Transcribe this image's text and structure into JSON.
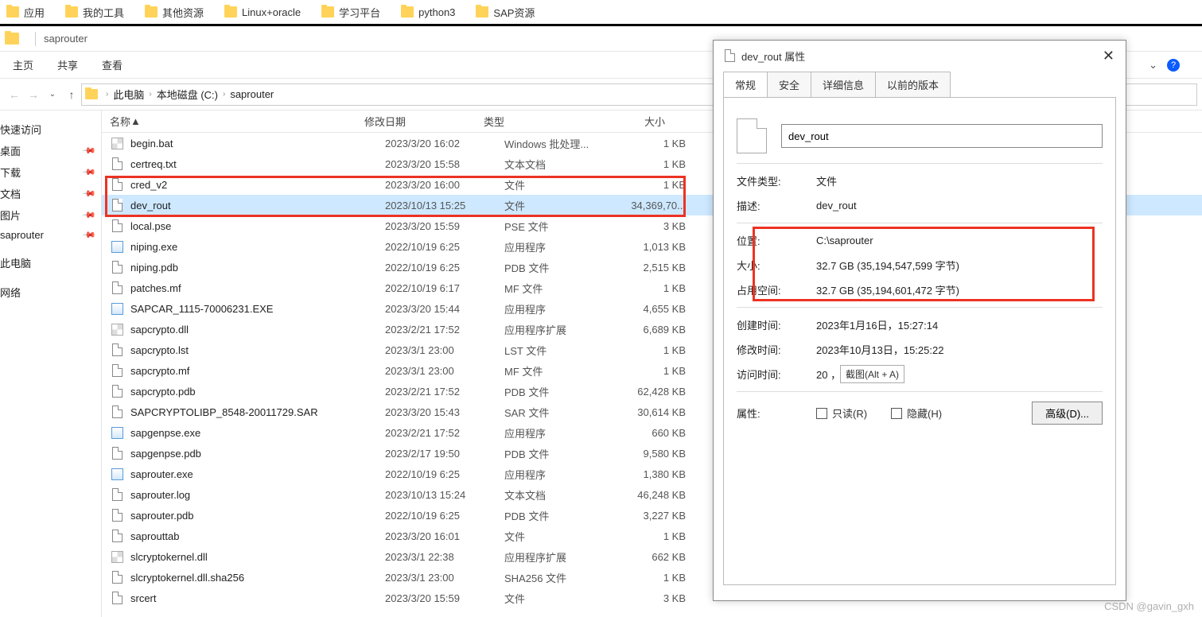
{
  "bookmarks": [
    "应用",
    "我的工具",
    "其他资源",
    "Linux+oracle",
    "学习平台",
    "python3",
    "SAP资源"
  ],
  "window_title": "saprouter",
  "ribbon": {
    "home": "主页",
    "share": "共享",
    "view": "查看"
  },
  "breadcrumb": {
    "pc": "此电脑",
    "drive": "本地磁盘 (C:)",
    "folder": "saprouter"
  },
  "columns": {
    "name": "名称",
    "date": "修改日期",
    "type": "类型",
    "size": "大小"
  },
  "sidebar": {
    "quick": "快速访问",
    "items": [
      "桌面",
      "下载",
      "文档",
      "图片",
      "saprouter"
    ],
    "pc": "此电脑",
    "net": "网络"
  },
  "files": [
    {
      "n": "begin.bat",
      "d": "2023/3/20 16:02",
      "t": "Windows 批处理...",
      "s": "1 KB",
      "ic": "sys"
    },
    {
      "n": "certreq.txt",
      "d": "2023/3/20 15:58",
      "t": "文本文档",
      "s": "1 KB",
      "ic": "file"
    },
    {
      "n": "cred_v2",
      "d": "2023/3/20 16:00",
      "t": "文件",
      "s": "1 KB",
      "ic": "file"
    },
    {
      "n": "dev_rout",
      "d": "2023/10/13 15:25",
      "t": "文件",
      "s": "34,369,70...",
      "ic": "file",
      "sel": true
    },
    {
      "n": "local.pse",
      "d": "2023/3/20 15:59",
      "t": "PSE 文件",
      "s": "3 KB",
      "ic": "file"
    },
    {
      "n": "niping.exe",
      "d": "2022/10/19 6:25",
      "t": "应用程序",
      "s": "1,013 KB",
      "ic": "exe"
    },
    {
      "n": "niping.pdb",
      "d": "2022/10/19 6:25",
      "t": "PDB 文件",
      "s": "2,515 KB",
      "ic": "file"
    },
    {
      "n": "patches.mf",
      "d": "2022/10/19 6:17",
      "t": "MF 文件",
      "s": "1 KB",
      "ic": "file"
    },
    {
      "n": "SAPCAR_1115-70006231.EXE",
      "d": "2023/3/20 15:44",
      "t": "应用程序",
      "s": "4,655 KB",
      "ic": "exe"
    },
    {
      "n": "sapcrypto.dll",
      "d": "2023/2/21 17:52",
      "t": "应用程序扩展",
      "s": "6,689 KB",
      "ic": "sys"
    },
    {
      "n": "sapcrypto.lst",
      "d": "2023/3/1 23:00",
      "t": "LST 文件",
      "s": "1 KB",
      "ic": "file"
    },
    {
      "n": "sapcrypto.mf",
      "d": "2023/3/1 23:00",
      "t": "MF 文件",
      "s": "1 KB",
      "ic": "file"
    },
    {
      "n": "sapcrypto.pdb",
      "d": "2023/2/21 17:52",
      "t": "PDB 文件",
      "s": "62,428 KB",
      "ic": "file"
    },
    {
      "n": "SAPCRYPTOLIBP_8548-20011729.SAR",
      "d": "2023/3/20 15:43",
      "t": "SAR 文件",
      "s": "30,614 KB",
      "ic": "file"
    },
    {
      "n": "sapgenpse.exe",
      "d": "2023/2/21 17:52",
      "t": "应用程序",
      "s": "660 KB",
      "ic": "exe"
    },
    {
      "n": "sapgenpse.pdb",
      "d": "2023/2/17 19:50",
      "t": "PDB 文件",
      "s": "9,580 KB",
      "ic": "file"
    },
    {
      "n": "saprouter.exe",
      "d": "2022/10/19 6:25",
      "t": "应用程序",
      "s": "1,380 KB",
      "ic": "exe"
    },
    {
      "n": "saprouter.log",
      "d": "2023/10/13 15:24",
      "t": "文本文档",
      "s": "46,248 KB",
      "ic": "file"
    },
    {
      "n": "saprouter.pdb",
      "d": "2022/10/19 6:25",
      "t": "PDB 文件",
      "s": "3,227 KB",
      "ic": "file"
    },
    {
      "n": "saprouttab",
      "d": "2023/3/20 16:01",
      "t": "文件",
      "s": "1 KB",
      "ic": "file"
    },
    {
      "n": "slcryptokernel.dll",
      "d": "2023/3/1 22:38",
      "t": "应用程序扩展",
      "s": "662 KB",
      "ic": "sys"
    },
    {
      "n": "slcryptokernel.dll.sha256",
      "d": "2023/3/1 23:00",
      "t": "SHA256 文件",
      "s": "1 KB",
      "ic": "file"
    },
    {
      "n": "srcert",
      "d": "2023/3/20 15:59",
      "t": "文件",
      "s": "3 KB",
      "ic": "file"
    }
  ],
  "dialog": {
    "title": "dev_rout 属性",
    "tabs": [
      "常规",
      "安全",
      "详细信息",
      "以前的版本"
    ],
    "name": "dev_rout",
    "rows": {
      "type_l": "文件类型:",
      "type_v": "文件",
      "desc_l": "描述:",
      "desc_v": "dev_rout",
      "loc_l": "位置:",
      "loc_v": "C:\\saprouter",
      "size_l": "大小:",
      "size_v": "32.7 GB (35,194,547,599 字节)",
      "disk_l": "占用空间:",
      "disk_v": "32.7 GB (35,194,601,472 字节)",
      "created_l": "创建时间:",
      "created_v": "2023年1月16日，15:27:14",
      "modified_l": "修改时间:",
      "modified_v": "2023年10月13日，15:25:22",
      "accessed_l": "访问时间:",
      "accessed_v": "20                           ，15:25:21",
      "attr_l": "属性:",
      "readonly": "只读(R)",
      "hidden": "隐藏(H)",
      "advanced": "高级(D)..."
    },
    "tooltip": "截图(Alt + A)"
  },
  "watermark": "CSDN @gavin_gxh"
}
